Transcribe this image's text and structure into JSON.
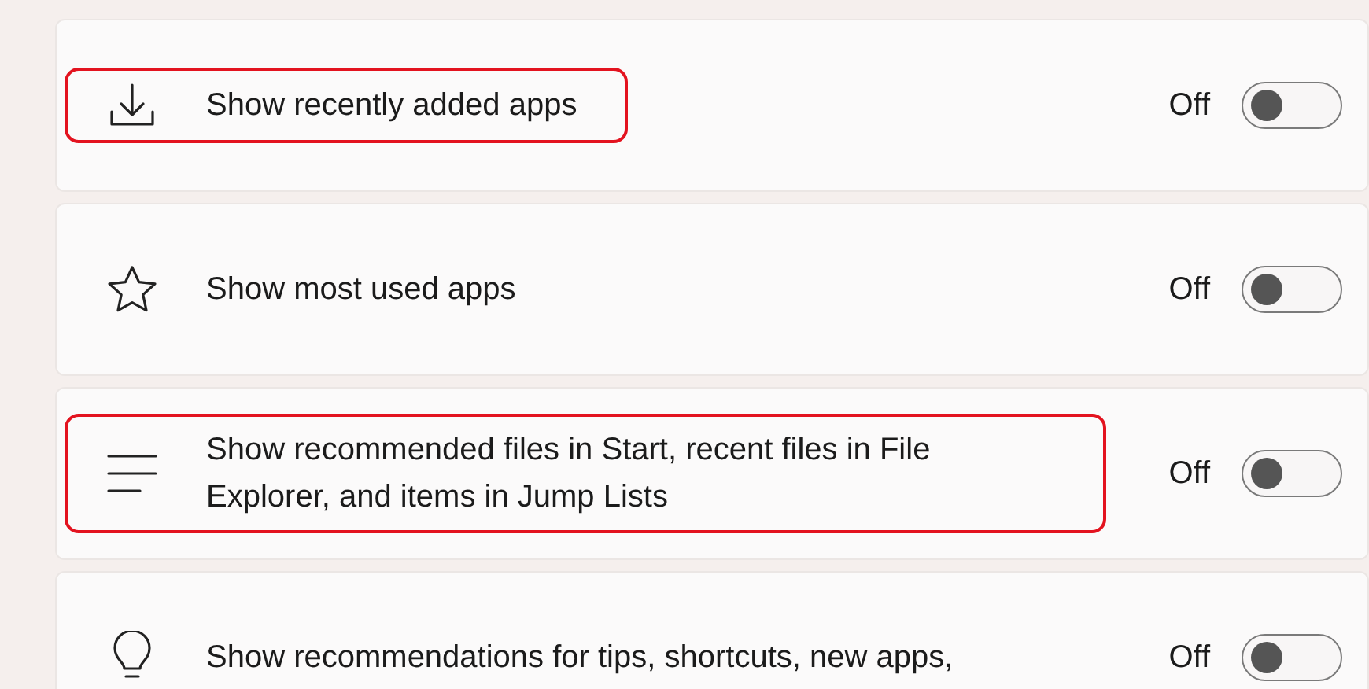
{
  "settings": [
    {
      "kind": "download",
      "label": "Show recently added apps",
      "highlighted": true,
      "state_text": "Off",
      "on": false
    },
    {
      "kind": "star",
      "label": "Show most used apps",
      "highlighted": false,
      "state_text": "Off",
      "on": false
    },
    {
      "kind": "lines",
      "label": "Show recommended files in Start, recent files in File Explorer, and items in Jump Lists",
      "highlighted": true,
      "state_text": "Off",
      "on": false
    },
    {
      "kind": "bulb",
      "label": "Show recommendations for tips, shortcuts, new apps,",
      "highlighted": false,
      "state_text": "Off",
      "on": false
    }
  ]
}
